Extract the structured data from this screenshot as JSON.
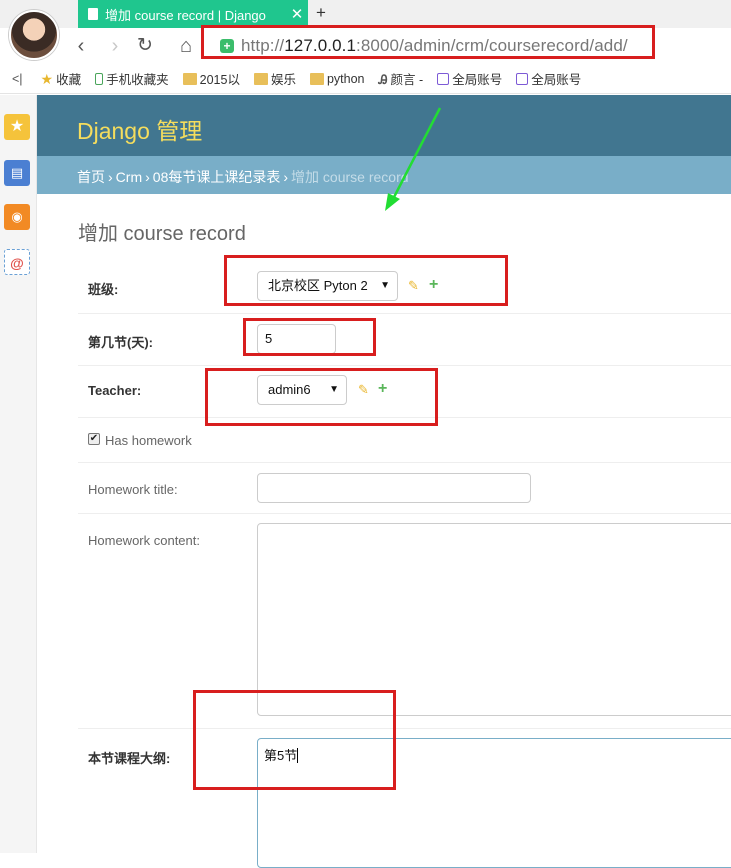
{
  "browser": {
    "tab_title": "增加 course record | Django",
    "tab_close": "✕",
    "new_tab": "+",
    "url_prefix": "http://",
    "url_host": "127.0.0.1",
    "url_rest": ":8000/admin/crm/courserecord/add/",
    "nav": {
      "back": "‹",
      "forward": "›",
      "reload": "↻",
      "home": "⌂"
    }
  },
  "bookmarks": {
    "collapse": "<|",
    "items": [
      {
        "label": "收藏",
        "icon": "star-icon"
      },
      {
        "label": "手机收藏夹",
        "icon": "phone-icon"
      },
      {
        "label": "2015以",
        "icon": "folder-icon"
      },
      {
        "label": "娱乐",
        "icon": "folder-icon"
      },
      {
        "label": "python",
        "icon": "folder-icon"
      },
      {
        "label": "颜言 -",
        "icon": "script-icon"
      },
      {
        "label": "全局账号",
        "icon": "note-icon"
      },
      {
        "label": "全局账号",
        "icon": "note-icon"
      }
    ]
  },
  "admin": {
    "site_name": "Django 管理",
    "breadcrumbs": {
      "home": "首页",
      "app": "Crm",
      "model": "08每节课上课纪录表",
      "current": "增加 course record"
    },
    "page_title": "增加 course record",
    "fields": {
      "class_grade": {
        "label": "班级:",
        "value": "北京校区 Pyton 2"
      },
      "day_num": {
        "label": "第几节(天):",
        "value": "5"
      },
      "teacher": {
        "label": "Teacher:",
        "value": "admin6"
      },
      "has_homework": {
        "label": "Has homework",
        "checked": true
      },
      "homework_title": {
        "label": "Homework title:",
        "value": ""
      },
      "homework_content": {
        "label": "Homework content:",
        "value": ""
      },
      "outline": {
        "label": "本节课程大纲:",
        "value": "第5节"
      }
    },
    "icons": {
      "edit": "✎",
      "add": "+",
      "dropdown": "▼",
      "check": "✔"
    }
  },
  "colors": {
    "header_bg": "#417690",
    "breadcrumb_bg": "#79aec8",
    "site_name": "#f5dd5d",
    "tab_active": "#1fc68e",
    "annotation_red": "#d81e1e",
    "annotation_green": "#22dd33"
  }
}
